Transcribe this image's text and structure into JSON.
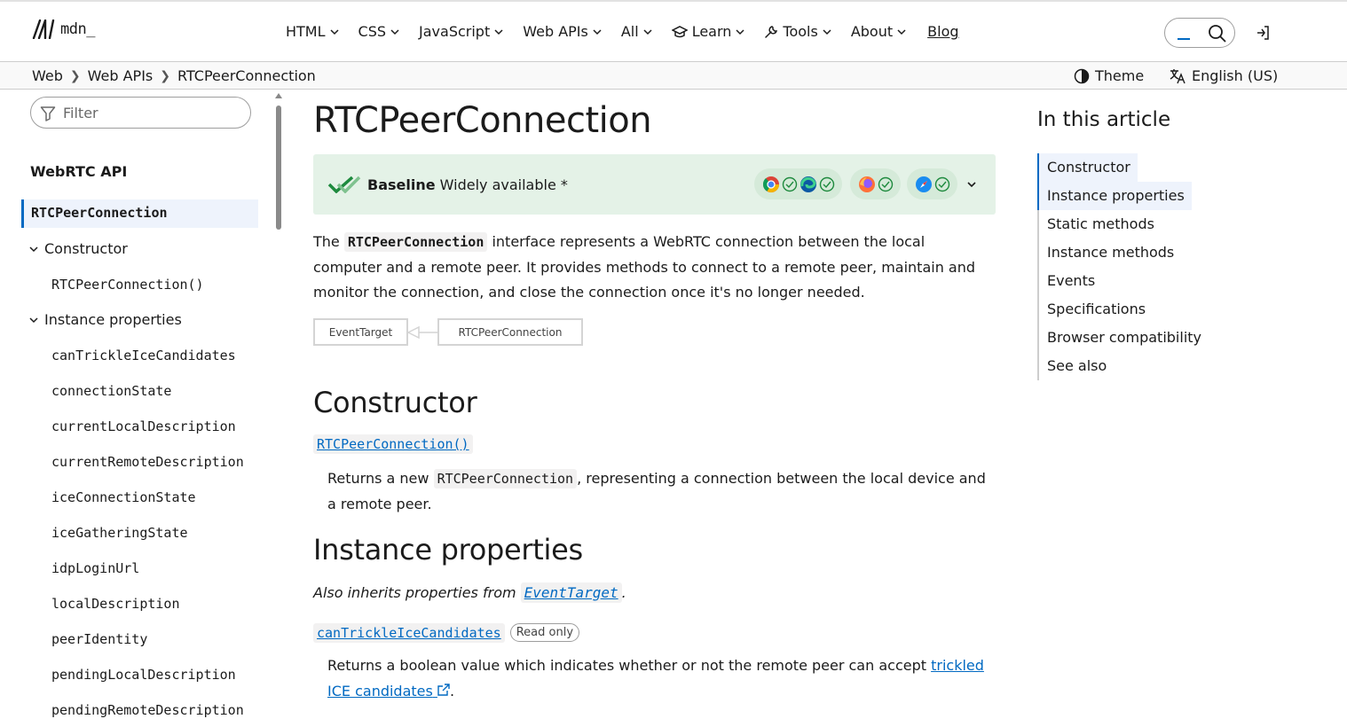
{
  "header": {
    "logo_text": "mdn_",
    "nav": [
      {
        "label": "HTML",
        "dropdown": true
      },
      {
        "label": "CSS",
        "dropdown": true
      },
      {
        "label": "JavaScript",
        "dropdown": true
      },
      {
        "label": "Web APIs",
        "dropdown": true
      },
      {
        "label": "All",
        "dropdown": true
      },
      {
        "label": "Learn",
        "dropdown": true,
        "icon": "graduation-cap-icon"
      },
      {
        "label": "Tools",
        "dropdown": true,
        "icon": "wrench-icon"
      },
      {
        "label": "About",
        "dropdown": true
      },
      {
        "label": "Blog",
        "dropdown": false
      }
    ]
  },
  "breadcrumb": {
    "items": [
      "Web",
      "Web APIs",
      "RTCPeerConnection"
    ],
    "theme_label": "Theme",
    "language_label": "English (US)"
  },
  "sidebar": {
    "filter_placeholder": "Filter",
    "title": "WebRTC API",
    "active": "RTCPeerConnection",
    "constructor_group": "Constructor",
    "constructor_items": [
      "RTCPeerConnection()"
    ],
    "properties_group": "Instance properties",
    "property_items": [
      "canTrickleIceCandidates",
      "connectionState",
      "currentLocalDescription",
      "currentRemoteDescription",
      "iceConnectionState",
      "iceGatheringState",
      "idpLoginUrl",
      "localDescription",
      "peerIdentity",
      "pendingLocalDescription",
      "pendingRemoteDescription"
    ]
  },
  "main": {
    "title": "RTCPeerConnection",
    "baseline": {
      "strong": "Baseline",
      "rest": "Widely available *"
    },
    "intro": {
      "before": "The ",
      "code": "RTCPeerConnection",
      "after": " interface represents a WebRTC connection between the local computer and a remote peer. It provides methods to connect to a remote peer, maintain and monitor the connection, and close the connection once it's no longer needed."
    },
    "diagram": {
      "parent": "EventTarget",
      "child": "RTCPeerConnection"
    },
    "constructor_heading": "Constructor",
    "constructor_link": "RTCPeerConnection()",
    "constructor_desc": {
      "before": "Returns a new ",
      "code": "RTCPeerConnection",
      "after": ", representing a connection between the local device and a remote peer."
    },
    "properties_heading": "Instance properties",
    "inherits": {
      "before": "Also inherits properties from ",
      "link": "EventTarget",
      "after": "."
    },
    "property1": {
      "name": "canTrickleIceCandidates",
      "badge": "Read only",
      "desc_before": "Returns a boolean value which indicates whether or not the remote peer can accept ",
      "desc_link": "trickled ICE candidates",
      "desc_after": "."
    }
  },
  "toc": {
    "title": "In this article",
    "items": [
      "Constructor",
      "Instance properties",
      "Static methods",
      "Instance methods",
      "Events",
      "Specifications",
      "Browser compatibility",
      "See also"
    ]
  },
  "colors": {
    "accent": "#0069c2",
    "baseline_bg": "#e4f2e7",
    "baseline_check": "#1e8a3e"
  }
}
